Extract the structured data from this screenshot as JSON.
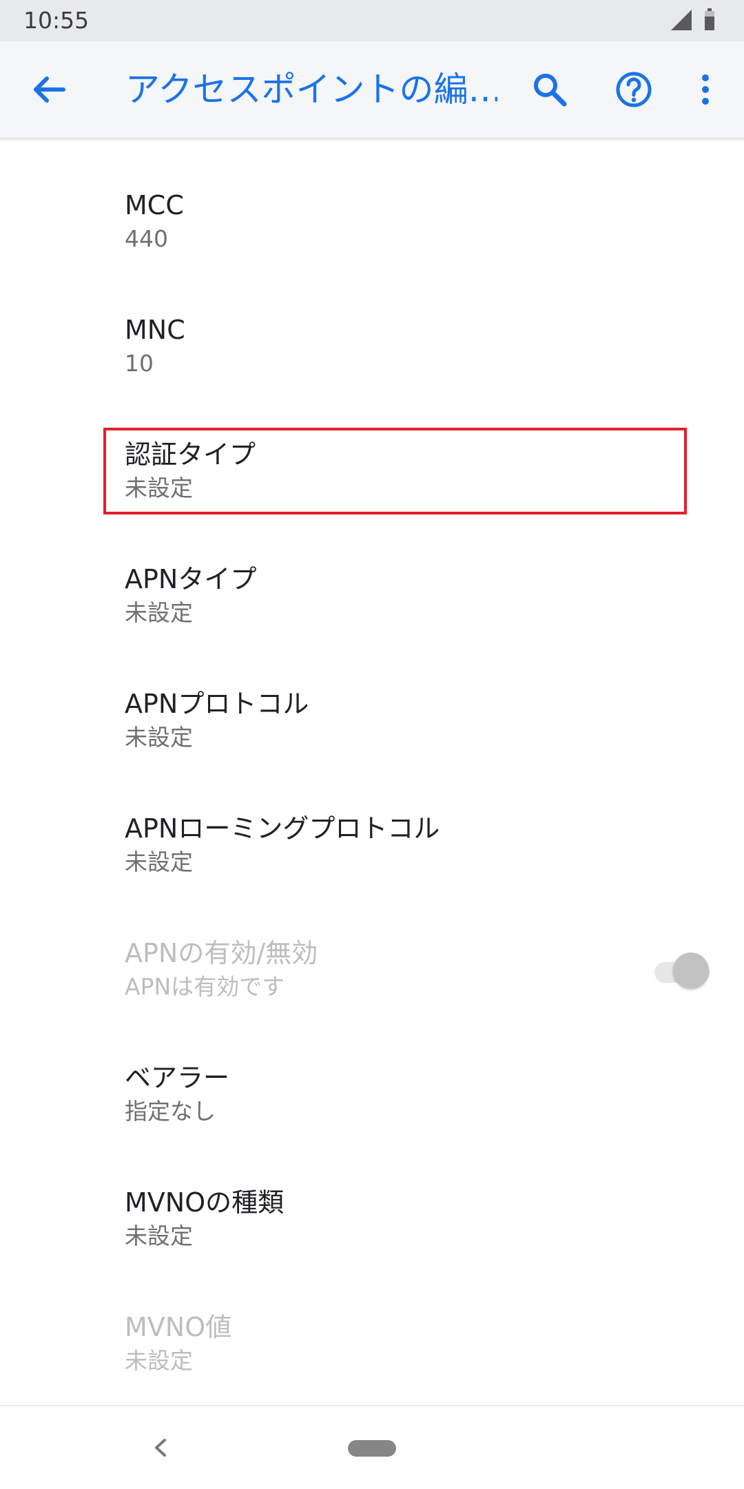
{
  "status_bar": {
    "time": "10:55",
    "icons": [
      "signal-icon",
      "battery-icon"
    ]
  },
  "app_bar": {
    "title": "アクセスポイントの編…",
    "icons": [
      "back-arrow-icon",
      "search-icon",
      "help-icon",
      "overflow-menu-icon"
    ],
    "accent_color": "#1a73e8"
  },
  "preferences": [
    {
      "title": "MCC",
      "summary": "440"
    },
    {
      "title": "MNC",
      "summary": "10"
    },
    {
      "title": "認証タイプ",
      "summary": "未設定"
    },
    {
      "title": "APNタイプ",
      "summary": "未設定"
    },
    {
      "title": "APNプロトコル",
      "summary": "未設定"
    },
    {
      "title": "APNローミングプロトコル",
      "summary": "未設定"
    },
    {
      "title": "APNの有効/無効",
      "summary": "APNは有効です"
    },
    {
      "title": "ベアラー",
      "summary": "指定なし"
    },
    {
      "title": "MVNOの種類",
      "summary": "未設定"
    },
    {
      "title": "MVNO値",
      "summary": "未設定"
    }
  ],
  "apn_toggle": {
    "state": "on",
    "enabled": false
  },
  "highlight": {
    "target": "認証タイプ",
    "color": "#e41e2b"
  },
  "nav_bar": {
    "icons": [
      "nav-back-icon",
      "home-pill-icon"
    ]
  }
}
